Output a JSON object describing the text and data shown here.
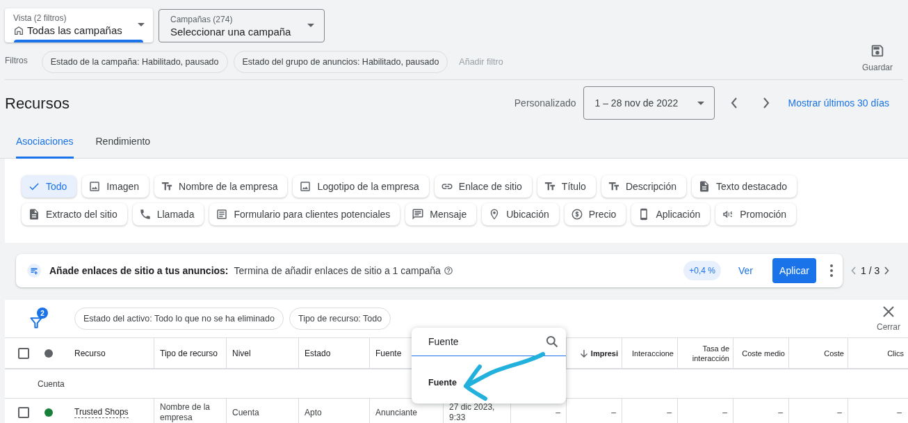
{
  "view_selector": {
    "label": "Vista (2 filtros)",
    "value": "Todas las campañas"
  },
  "campaign_selector": {
    "label": "Campañas (274)",
    "value": "Seleccionar una campaña"
  },
  "filters": {
    "label": "Filtros",
    "chips": [
      "Estado de la campaña: Habilitado, pausado",
      "Estado del grupo de anuncios: Habilitado, pausado"
    ],
    "add_filter": "Añadir filtro"
  },
  "save_button": "Guardar",
  "page_title": "Recursos",
  "date_range": {
    "label": "Personalizado",
    "value": "1 – 28 nov de 2022",
    "link": "Mostrar últimos 30 días"
  },
  "tabs": [
    {
      "label": "Asociaciones",
      "selected": true
    },
    {
      "label": "Rendimiento",
      "selected": false
    }
  ],
  "chip_rows": [
    {
      "chips": [
        {
          "label": "Todo",
          "kind": "check",
          "selected": true
        },
        {
          "label": "Imagen",
          "kind": "image",
          "selected": false
        },
        {
          "label": "Nombre de la empresa",
          "kind": "text",
          "selected": false
        },
        {
          "label": "Logotipo de la empresa",
          "kind": "image",
          "selected": false
        },
        {
          "label": "Enlace de sitio",
          "kind": "link",
          "selected": false
        },
        {
          "label": "Título",
          "kind": "text",
          "selected": false
        },
        {
          "label": "Descripción",
          "kind": "text",
          "selected": false
        },
        {
          "label": "Texto destacado",
          "kind": "document",
          "selected": false
        }
      ]
    },
    {
      "chips": [
        {
          "label": "Extracto del sitio",
          "kind": "document",
          "selected": false
        },
        {
          "label": "Llamada",
          "kind": "phone",
          "selected": false
        },
        {
          "label": "Formulario para clientes potenciales",
          "kind": "form",
          "selected": false
        },
        {
          "label": "Mensaje",
          "kind": "message",
          "selected": false
        },
        {
          "label": "Ubicación",
          "kind": "pin",
          "selected": false
        },
        {
          "label": "Precio",
          "kind": "price",
          "selected": false
        },
        {
          "label": "Aplicación",
          "kind": "mobile",
          "selected": false
        },
        {
          "label": "Promoción",
          "kind": "megaphone",
          "selected": false
        }
      ]
    }
  ],
  "recommendation": {
    "title": "Añade enlaces de sitio a tus anuncios:",
    "text": "Termina de añadir enlaces de sitio a 1 campaña",
    "uplift": "+0,4 %",
    "view": "Ver",
    "apply": "Aplicar",
    "pager": "1 / 3"
  },
  "table_filters": {
    "count": "2",
    "chips": [
      "Estado del activo: Todo lo que no se ha eliminado",
      "Tipo de recurso: Todo"
    ],
    "close": "Cerrar"
  },
  "all_selected": false,
  "columns": [
    {
      "label": "Recurso",
      "sorted": false
    },
    {
      "label": "Tipo de recurso",
      "sorted": false
    },
    {
      "label": "Nivel",
      "sorted": false
    },
    {
      "label": "Estado",
      "sorted": false
    },
    {
      "label": "Fuente",
      "sorted": false
    },
    {
      "label": "Impresi",
      "sorted": true
    },
    {
      "label": "Interaccione",
      "sorted": false
    },
    {
      "label": "Tasa de interacción",
      "sorted": false
    },
    {
      "label": "Coste medio",
      "sorted": false
    },
    {
      "label": "Coste",
      "sorted": false
    },
    {
      "label": "Clics",
      "sorted": false
    }
  ],
  "group_label": "Cuenta",
  "rows": [
    {
      "checked": false,
      "color": "#188038",
      "cells": [
        "Trusted Shops",
        "Nombre de la empresa",
        "Cuenta",
        "Apto",
        "Anunciante",
        "27 dic 2023, 9:33",
        "–",
        "–",
        "–",
        "–",
        "–",
        "–",
        "–"
      ]
    }
  ],
  "column_search": {
    "value": "Fuente",
    "option": "Fuente"
  }
}
